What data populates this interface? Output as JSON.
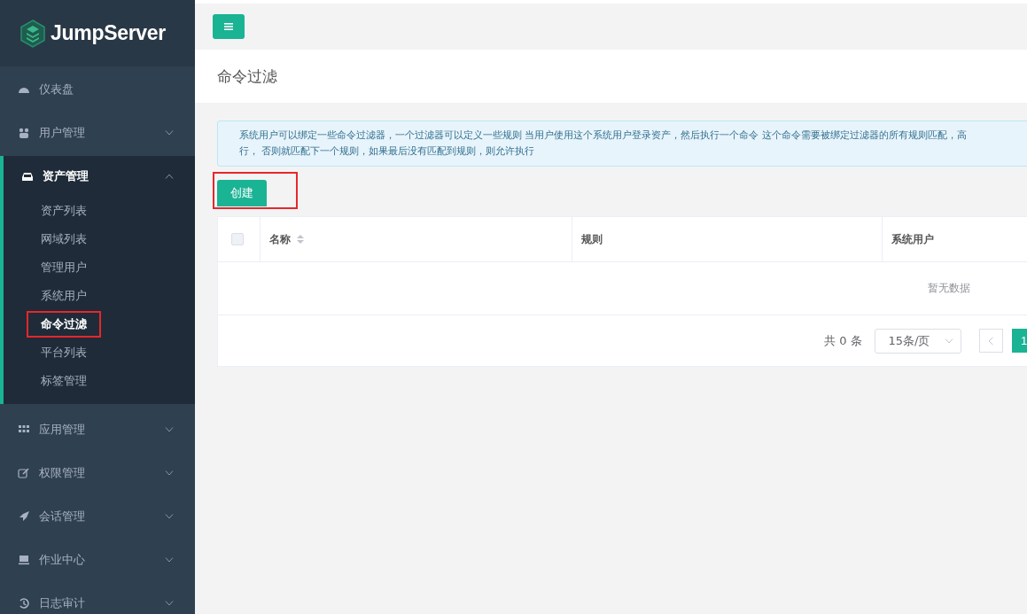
{
  "brand": {
    "name": "JumpServer"
  },
  "sidebar": {
    "items": [
      {
        "label": "仪表盘",
        "expandable": false,
        "expanded": false
      },
      {
        "label": "用户管理",
        "expandable": true,
        "expanded": false
      },
      {
        "label": "资产管理",
        "expandable": true,
        "expanded": true,
        "children": [
          {
            "label": "资产列表",
            "selected": false,
            "highlighted": false
          },
          {
            "label": "网域列表",
            "selected": false,
            "highlighted": false
          },
          {
            "label": "管理用户",
            "selected": false,
            "highlighted": false
          },
          {
            "label": "系统用户",
            "selected": false,
            "highlighted": false
          },
          {
            "label": "命令过滤",
            "selected": true,
            "highlighted": true
          },
          {
            "label": "平台列表",
            "selected": false,
            "highlighted": false
          },
          {
            "label": "标签管理",
            "selected": false,
            "highlighted": false
          }
        ]
      },
      {
        "label": "应用管理",
        "expandable": true,
        "expanded": false
      },
      {
        "label": "权限管理",
        "expandable": true,
        "expanded": false
      },
      {
        "label": "会话管理",
        "expandable": true,
        "expanded": false
      },
      {
        "label": "作业中心",
        "expandable": true,
        "expanded": false
      },
      {
        "label": "日志审计",
        "expandable": true,
        "expanded": false
      }
    ]
  },
  "page": {
    "title": "命令过滤"
  },
  "alert": {
    "lines": [
      "系统用户可以绑定一些命令过滤器，一个过滤器可以定义一些规则 当用户使用这个系统用户登录资产，然后执行一个命令 这个命令需要被绑定过滤器的所有规则匹配，高",
      "行， 否则就匹配下一个规则，如果最后没有匹配到规则，则允许执行"
    ]
  },
  "create_button": {
    "label": "创建",
    "highlighted": true
  },
  "table": {
    "select_all": {
      "checked": false
    },
    "columns": [
      {
        "label": "名称",
        "sortable": true
      },
      {
        "label": "规则",
        "sortable": false
      },
      {
        "label": "系统用户",
        "sortable": false
      }
    ],
    "empty_text": "暂无数据"
  },
  "pagination": {
    "total": "共 0 条",
    "page_size": "15条/页",
    "pages": [
      {
        "label": "1",
        "selected": true
      }
    ]
  }
}
